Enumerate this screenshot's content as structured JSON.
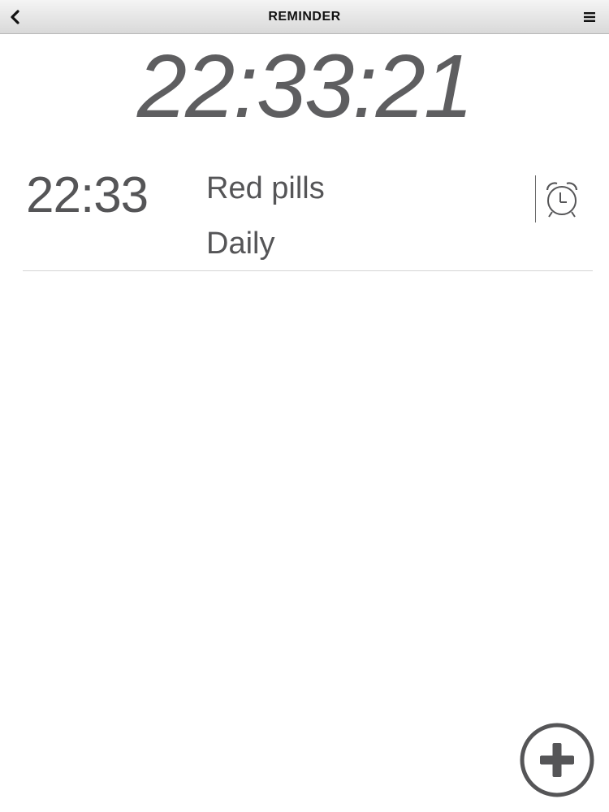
{
  "header": {
    "title": "REMINDER",
    "back_icon": "chevron-left-icon",
    "menu_icon": "hamburger-menu-icon"
  },
  "clock": {
    "current_time": "22:33:21"
  },
  "reminders": [
    {
      "time": "22:33",
      "name": "Red pills",
      "repeat": "Daily",
      "icon": "alarm-clock-icon"
    }
  ],
  "actions": {
    "add_icon": "add-circle-icon"
  },
  "colors": {
    "text": "#555557",
    "clock": "#5e5e60",
    "header_top": "#f4f4f4",
    "header_bottom": "#d9d9d9"
  }
}
